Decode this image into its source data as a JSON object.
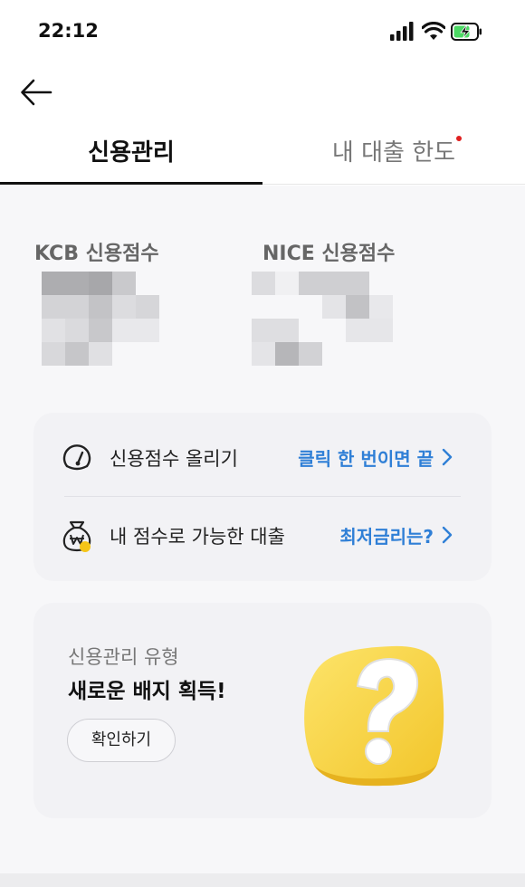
{
  "status_bar": {
    "time": "22:12",
    "icons": [
      "signal-icon",
      "wifi-icon",
      "battery-charging-icon"
    ]
  },
  "nav": {
    "back_icon": "back-arrow-icon"
  },
  "tabs": [
    {
      "label": "신용관리",
      "active": true
    },
    {
      "label": "내 대출 한도",
      "active": false,
      "has_notification_dot": true
    }
  ],
  "scores": {
    "kcb_label": "KCB 신용점수",
    "nice_label": "NICE 신용점수"
  },
  "menu": [
    {
      "icon": "gauge-icon",
      "label": "신용점수 올리기",
      "action": "클릭 한 번이면 끝"
    },
    {
      "icon": "money-bag-won-icon",
      "label": "내 점수로 가능한 대출",
      "action": "최저금리는?"
    }
  ],
  "badge_card": {
    "subtitle": "신용관리 유형",
    "title": "새로운 배지 획득!",
    "button_label": "확인하기",
    "art_icon": "question-mark-badge-icon"
  },
  "colors": {
    "accent": "#2f7fd6",
    "dot": "#e02020",
    "battery": "#4cd964",
    "badge_yellow": "#f5d43a"
  }
}
